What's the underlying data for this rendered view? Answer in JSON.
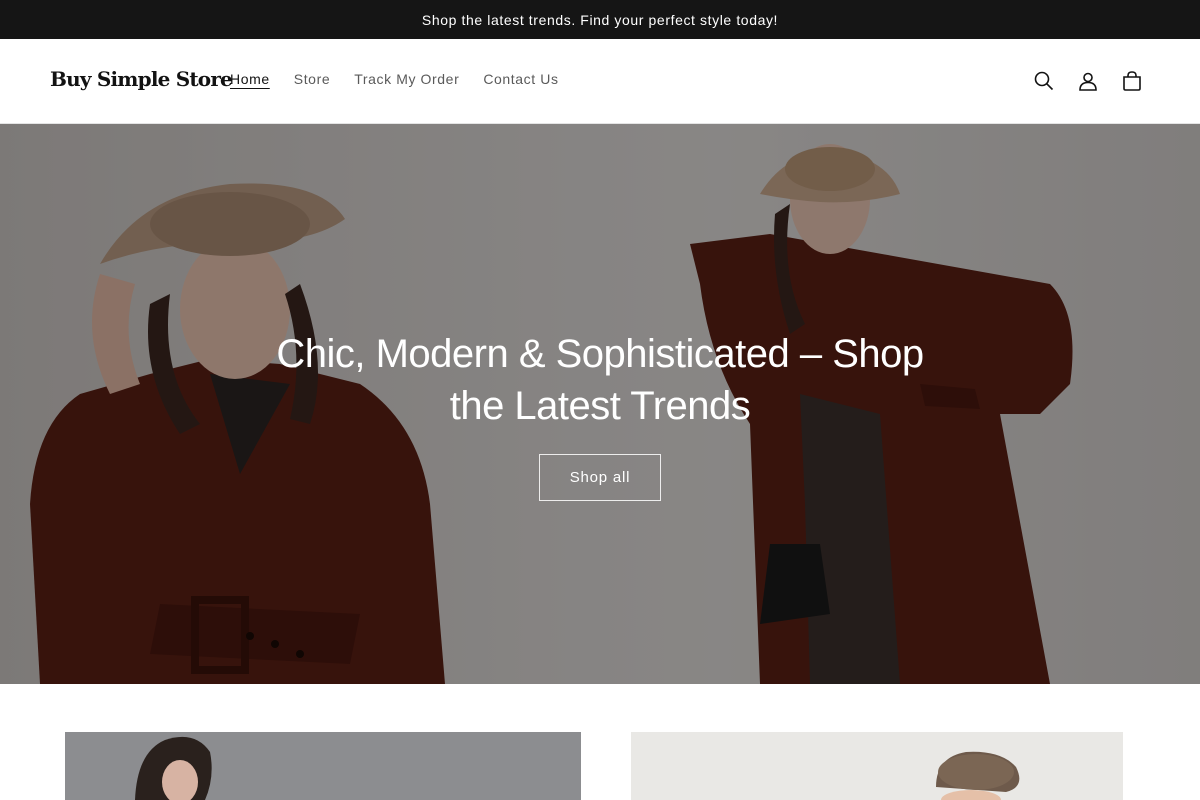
{
  "announcement": {
    "text": "Shop the latest trends. Find your perfect style today!"
  },
  "header": {
    "logo": "Buy Simple Store",
    "nav": [
      {
        "label": "Home",
        "active": true
      },
      {
        "label": "Store",
        "active": false
      },
      {
        "label": "Track My Order",
        "active": false
      },
      {
        "label": "Contact Us",
        "active": false
      }
    ],
    "icons": [
      "search-icon",
      "account-icon",
      "cart-icon"
    ]
  },
  "hero": {
    "title": "Chic, Modern & Sophisticated – Shop the Latest Trends",
    "button_label": "Shop all"
  },
  "colors": {
    "announcement_bg": "#151515",
    "coat": "#5a1f14",
    "hat": "#b89a82",
    "text_dark": "#121212"
  }
}
